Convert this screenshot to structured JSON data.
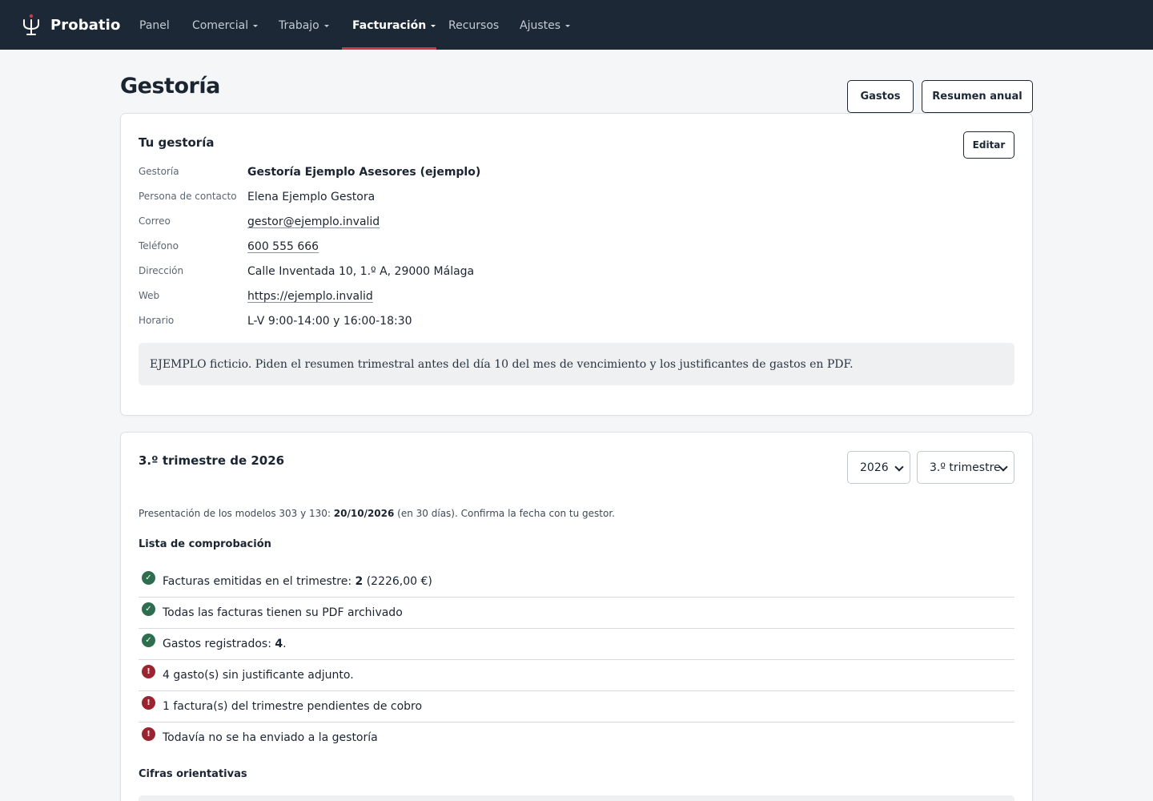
{
  "brand": {
    "name": "Probatio"
  },
  "nav": {
    "items": [
      {
        "label": "Panel",
        "has_menu": false,
        "active": false
      },
      {
        "label": "Comercial",
        "has_menu": true,
        "active": false
      },
      {
        "label": "Trabajo",
        "has_menu": true,
        "active": false
      },
      {
        "label": "Facturación",
        "has_menu": true,
        "active": true
      },
      {
        "label": "Recursos",
        "has_menu": false,
        "active": false
      },
      {
        "label": "Ajustes",
        "has_menu": true,
        "active": false
      }
    ]
  },
  "header": {
    "title": "Gestoría",
    "actions": {
      "gastos": "Gastos",
      "resumen": "Resumen anual"
    }
  },
  "gestoria_card": {
    "title": "Tu gestoría",
    "edit_label": "Editar",
    "fields": [
      {
        "label": "Gestoría",
        "value": "Gestoría Ejemplo Asesores (ejemplo)"
      },
      {
        "label": "Persona de contacto",
        "value": "Elena Ejemplo Gestora"
      },
      {
        "label": "Correo",
        "value": "gestor@ejemplo.invalid"
      },
      {
        "label": "Teléfono",
        "value": "600 555 666"
      },
      {
        "label": "Dirección",
        "value": "Calle Inventada 10, 1.º A, 29000 Málaga"
      },
      {
        "label": "Web",
        "value": "https://ejemplo.invalid"
      },
      {
        "label": "Horario",
        "value": "L-V 9:00-14:00 y 16:00-18:30"
      }
    ],
    "note": "EJEMPLO ficticio. Piden el resumen trimestral antes del día 10 del mes de vencimiento y los justificantes de gastos en PDF."
  },
  "quarter_card": {
    "title": "3.º trimestre de 2026",
    "year_select": "2026",
    "quarter_select": "3.º trimestre",
    "deadline": {
      "prefix": "Presentación de los modelos 303 y 130: ",
      "date": "20/10/2026",
      "suffix": " (en 30 días). Confirma la fecha con tu gestor."
    },
    "checklist_title": "Lista de comprobación",
    "checklist": [
      {
        "status": "ok",
        "text": "Facturas emitidas en el trimestre: ",
        "strong": "2",
        "after": " (2226,00 €)"
      },
      {
        "status": "ok",
        "text": "Todas las facturas tienen su PDF archivado",
        "strong": "",
        "after": ""
      },
      {
        "status": "ok",
        "text": "Gastos registrados: ",
        "strong": "4",
        "after": "."
      },
      {
        "status": "bad",
        "text": "4 gasto(s) sin justificante adjunto.",
        "strong": "",
        "after": ""
      },
      {
        "status": "bad",
        "text": "1 factura(s) del trimestre pendientes de cobro",
        "strong": "",
        "after": ""
      },
      {
        "status": "bad",
        "text": "Todavía no se ha enviado a la gestoría",
        "strong": "",
        "after": ""
      }
    ],
    "figures_title": "Cifras orientativas"
  },
  "colors": {
    "navbar_bg": "#1d2836",
    "active_underline": "#c73b44",
    "ok": "#2f6d4f",
    "bad": "#9a2530",
    "page_bg": "#f5f6f7"
  },
  "icons": {
    "ok": "check-circle-icon",
    "bad": "alert-circle-icon",
    "menu_caret": "caret-down-icon",
    "logo": "trident-logo-icon"
  }
}
